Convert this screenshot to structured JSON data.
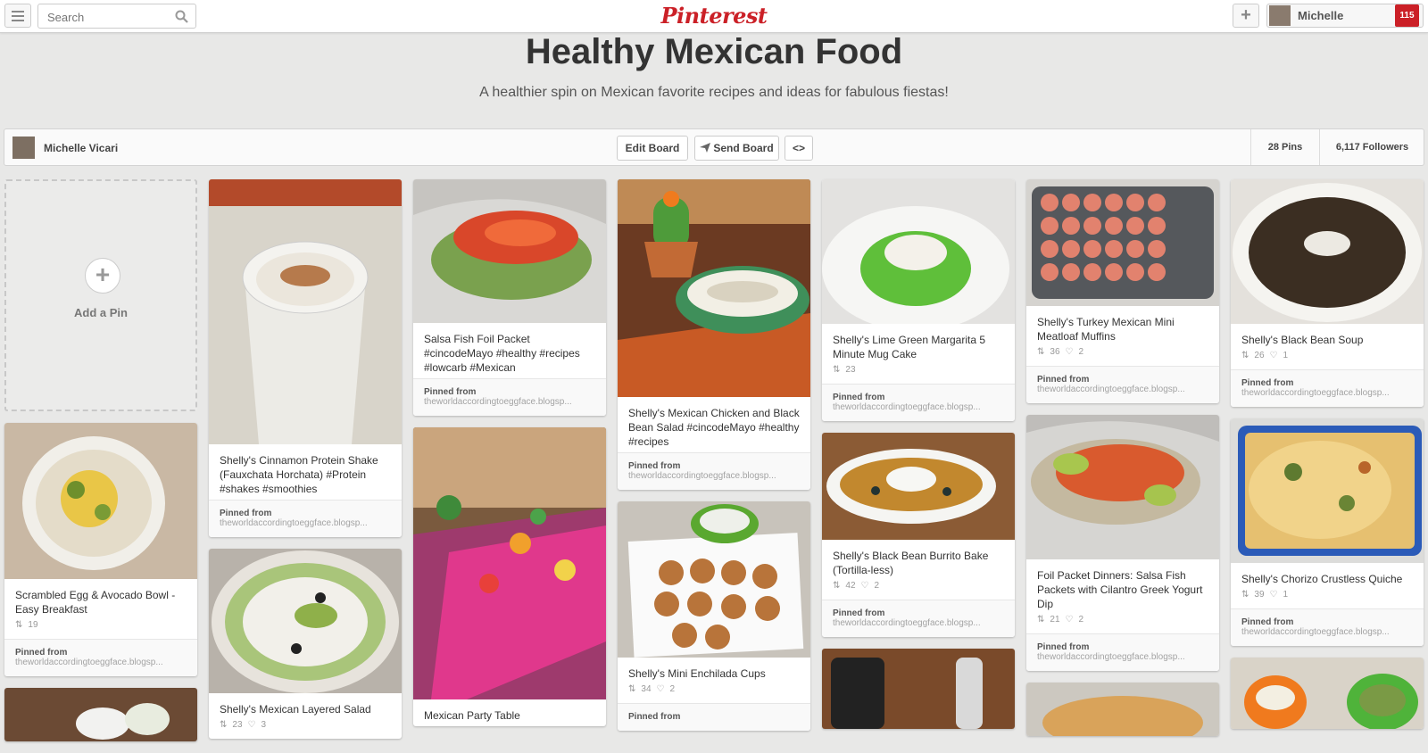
{
  "header": {
    "search_placeholder": "Search",
    "logo_text": "Pinterest",
    "user_name": "Michelle",
    "notification_count": "115"
  },
  "board": {
    "title": "Healthy Mexican Food",
    "description": "A healthier spin on Mexican favorite recipes and ideas for fabulous fiestas!",
    "owner": "Michelle Vicari",
    "edit_label": "Edit Board",
    "send_label": "Send Board",
    "embed_label": "<>",
    "pins_count": "28 Pins",
    "followers_count": "6,117 Followers"
  },
  "add_pin_label": "Add a Pin",
  "pinned_from_label": "Pinned from",
  "pins": [
    {
      "desc": "Scrambled Egg & Avocado Bowl - Easy Breakfast",
      "repins": "19",
      "likes": "",
      "source": "theworldaccordingtoeggface.blogsp..."
    },
    {
      "desc": "Shelly's Cinnamon Protein Shake (Fauxchata Horchata) #Protein #shakes #smoothies",
      "repins": "",
      "likes": "",
      "source": "theworldaccordingtoeggface.blogsp..."
    },
    {
      "desc": "Shelly's Mexican Layered Salad",
      "repins": "23",
      "likes": "3",
      "source": ""
    },
    {
      "desc": "Salsa Fish Foil Packet #cincodeMayo #healthy #recipes #lowcarb #Mexican",
      "repins": "",
      "likes": "",
      "source": "theworldaccordingtoeggface.blogsp..."
    },
    {
      "desc": "Mexican Party Table",
      "repins": "",
      "likes": "",
      "source": ""
    },
    {
      "desc": "Shelly's Mexican Chicken and Black Bean Salad #cincodeMayo #healthy #recipes",
      "repins": "",
      "likes": "",
      "source": "theworldaccordingtoeggface.blogsp..."
    },
    {
      "desc": "Shelly's Mini Enchilada Cups",
      "repins": "34",
      "likes": "2",
      "source": ""
    },
    {
      "desc": "Shelly's Lime Green Margarita 5 Minute Mug Cake",
      "repins": "23",
      "likes": "",
      "source": "theworldaccordingtoeggface.blogsp..."
    },
    {
      "desc": "Shelly's Black Bean Burrito Bake (Tortilla-less)",
      "repins": "42",
      "likes": "2",
      "source": "theworldaccordingtoeggface.blogsp..."
    },
    {
      "desc": "Shelly's Turkey Mexican Mini Meatloaf Muffins",
      "repins": "36",
      "likes": "2",
      "source": "theworldaccordingtoeggface.blogsp..."
    },
    {
      "desc": "Foil Packet Dinners: Salsa Fish Packets with Cilantro Greek Yogurt Dip",
      "repins": "21",
      "likes": "2",
      "source": "theworldaccordingtoeggface.blogsp..."
    },
    {
      "desc": "Shelly's Black Bean Soup",
      "repins": "26",
      "likes": "1",
      "source": "theworldaccordingtoeggface.blogsp..."
    },
    {
      "desc": "Shelly's Chorizo Crustless Quiche",
      "repins": "39",
      "likes": "1",
      "source": "theworldaccordingtoeggface.blogsp..."
    }
  ],
  "colors": {
    "brand": "#cb2027",
    "background": "#e8e8e7"
  }
}
